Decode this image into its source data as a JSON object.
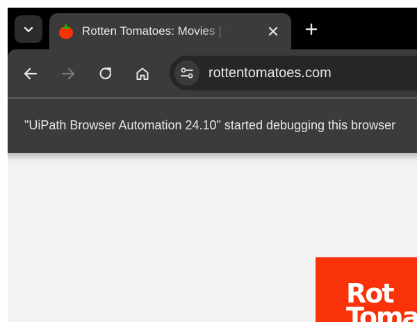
{
  "tab": {
    "title": "Rotten Tomatoes: Movies | TV Shows, Movie Trailers, Reviews - Rotten Tomatoes"
  },
  "icons": {
    "tab_dropdown": "chevron-down-icon",
    "favicon": "tomato-icon",
    "tab_close": "close-icon",
    "new_tab": "plus-icon",
    "back": "arrow-left-icon",
    "forward": "arrow-right-icon",
    "reload": "reload-icon",
    "home": "home-icon",
    "site_info": "tune-icon"
  },
  "address_bar": {
    "url": "rottentomatoes.com"
  },
  "infobar": {
    "message": "\"UiPath Browser Automation 24.10\" started debugging this browser"
  },
  "page": {
    "logo_text_line1": "Rot",
    "logo_text_line2": "Tomat"
  },
  "colors": {
    "tab_strip": "#000000",
    "toolbar": "#3b3b3b",
    "content_bg": "#f2f2f2",
    "brand_red": "#fa320a"
  }
}
